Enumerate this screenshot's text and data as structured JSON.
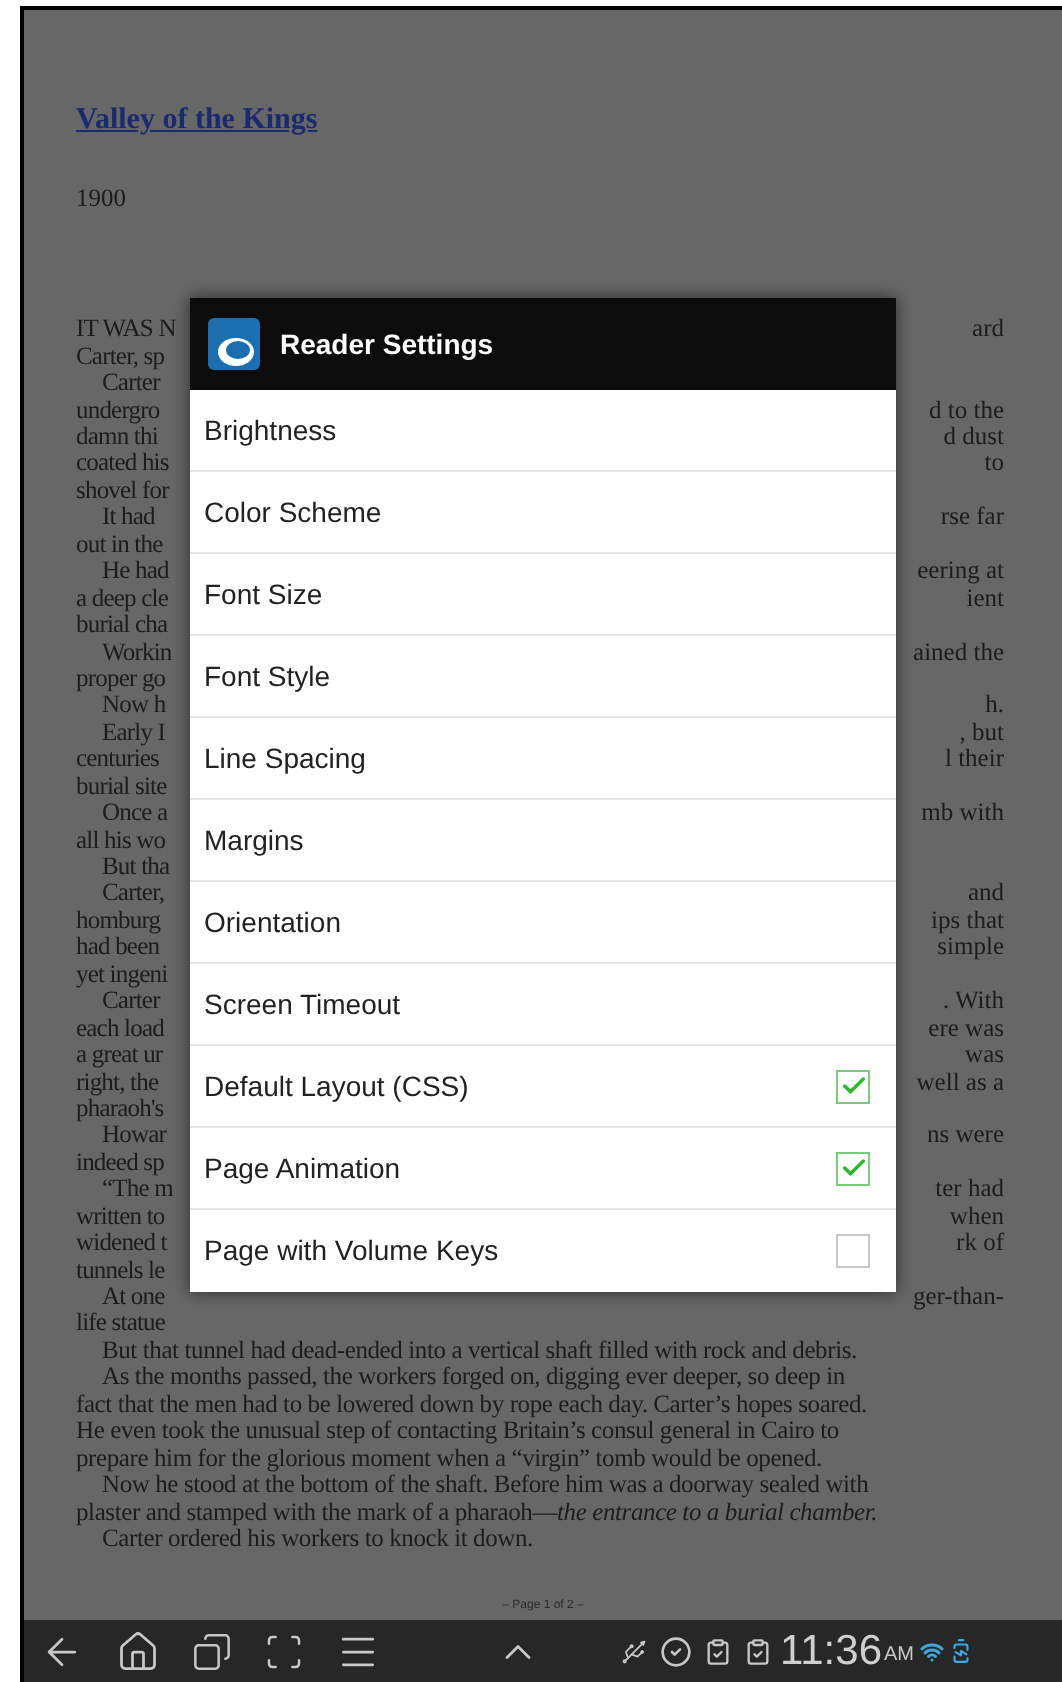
{
  "book": {
    "title": "Valley of the Kings",
    "year": "1900",
    "covered_lines": [
      {
        "left": "IT WAS N",
        "right": "ard",
        "indent": false
      },
      {
        "left": "Carter, sp",
        "indent": false
      },
      {
        "left": "Carter",
        "indent": true
      },
      {
        "left": "undergro",
        "right": "d to the",
        "indent": false
      },
      {
        "left": "damn thi",
        "right": "d dust",
        "indent": false
      },
      {
        "left": "coated his",
        "right": "to",
        "indent": false
      },
      {
        "left": "shovel for",
        "indent": false
      },
      {
        "left": "It had",
        "right": "rse far",
        "indent": true
      },
      {
        "left": "out in the",
        "indent": false
      },
      {
        "left": "He had",
        "right": "eering at",
        "indent": true
      },
      {
        "left": "a deep cle",
        "right": "ient",
        "indent": false
      },
      {
        "left": "burial cha",
        "indent": false
      },
      {
        "left": "Workin",
        "right": "ained the",
        "indent": true
      },
      {
        "left": "proper go",
        "indent": false
      },
      {
        "left": "Now h",
        "right": "h.",
        "indent": true
      },
      {
        "left": "Early I",
        "right": ", but",
        "indent": true
      },
      {
        "left": "centuries",
        "right": "l their",
        "indent": false
      },
      {
        "left": "burial site",
        "indent": false
      },
      {
        "left": "Once a",
        "right": "mb with",
        "indent": true
      },
      {
        "left": "all his wo",
        "indent": false
      },
      {
        "left": "But tha",
        "indent": true
      },
      {
        "left": "Carter,",
        "right": "and",
        "indent": true
      },
      {
        "left": "homburg",
        "right": "ips that",
        "indent": false
      },
      {
        "left": "had been",
        "right": "simple",
        "indent": false
      },
      {
        "left": "yet ingeni",
        "indent": false
      },
      {
        "left": "Carter",
        "right": ". With",
        "indent": true
      },
      {
        "left": "each load",
        "right": "ere was",
        "indent": false
      },
      {
        "left": "a great ur",
        "right": "was",
        "indent": false
      },
      {
        "left": "right, the",
        "right": "well as a",
        "indent": false
      },
      {
        "left": "pharaoh's",
        "indent": false
      },
      {
        "left": "Howar",
        "right": "ns were",
        "indent": true
      },
      {
        "left": "indeed sp",
        "indent": false
      },
      {
        "left": "“The m",
        "right": "ter had",
        "indent": true
      },
      {
        "left": "written to",
        "right": "when",
        "indent": false
      },
      {
        "left": "widened t",
        "right": "rk of",
        "indent": false
      },
      {
        "left": "tunnels le",
        "indent": false
      },
      {
        "left": "At one",
        "right": "ger-than-",
        "indent": true
      },
      {
        "left": "life statue",
        "indent": false
      }
    ],
    "lines": [
      {
        "text": "But that tunnel had dead-ended into a vertical shaft filled with rock and debris.",
        "indent": true
      },
      {
        "text": "As the months passed, the workers forged on, digging ever deeper, so deep in",
        "indent": true
      },
      {
        "text": "fact that the men had to be lowered down by rope each day. Carter’s hopes soared.",
        "indent": false
      },
      {
        "text": "He even took the unusual step of contacting Britain’s consul general in Cairo to",
        "indent": false
      },
      {
        "text": "prepare him for the glorious moment when a “virgin” tomb would be opened.",
        "indent": false
      },
      {
        "text": "Now he stood at the bottom of the shaft. Before him was a doorway sealed with",
        "indent": true
      },
      {
        "text": "plaster and stamped with the mark of a pharaoh—*the entrance to a burial chamber.*",
        "indent": false
      },
      {
        "text": "Carter ordered his workers to knock it down.",
        "indent": true
      }
    ],
    "page_number": "– Page 1 of 2 –"
  },
  "dialog": {
    "title": "Reader Settings",
    "items": [
      {
        "label": "Brightness",
        "kind": "menu"
      },
      {
        "label": "Color Scheme",
        "kind": "menu"
      },
      {
        "label": "Font Size",
        "kind": "menu"
      },
      {
        "label": "Font Style",
        "kind": "menu"
      },
      {
        "label": "Line Spacing",
        "kind": "menu"
      },
      {
        "label": "Margins",
        "kind": "menu"
      },
      {
        "label": "Orientation",
        "kind": "menu"
      },
      {
        "label": "Screen Timeout",
        "kind": "menu"
      },
      {
        "label": "Default Layout (CSS)",
        "kind": "checkbox",
        "checked": true
      },
      {
        "label": "Page Animation",
        "kind": "checkbox",
        "checked": true
      },
      {
        "label": "Page with Volume Keys",
        "kind": "checkbox",
        "checked": false
      }
    ]
  },
  "system_bar": {
    "time": "11:36",
    "meridiem": "AM"
  }
}
